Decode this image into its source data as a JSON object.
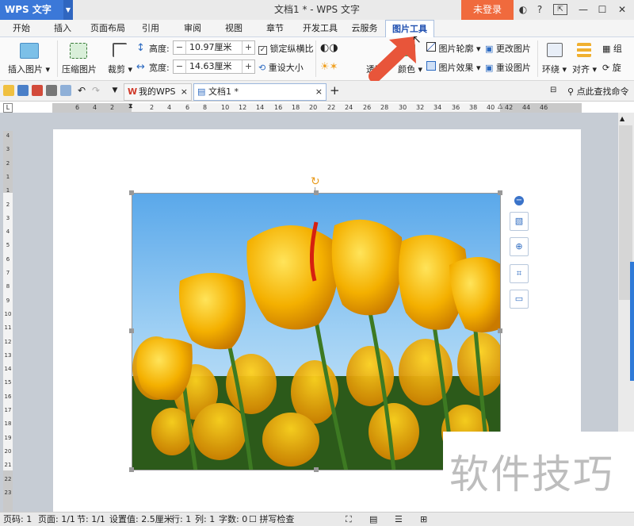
{
  "app": {
    "logo": "WPS 文字",
    "title": "文档1 * - WPS 文字",
    "login": "未登录"
  },
  "window_controls": {
    "help": "?",
    "minimize": "—",
    "restore": "☐",
    "close": "✕"
  },
  "tabs": [
    "开始",
    "插入",
    "页面布局",
    "引用",
    "审阅",
    "视图",
    "章节",
    "开发工具",
    "云服务",
    "图片工具"
  ],
  "active_tab": "图片工具",
  "ribbon": {
    "insert_picture": "插入图片",
    "compress_picture": "压缩图片",
    "crop": "裁剪",
    "height_label": "高度:",
    "height_value": "10.97厘米",
    "width_label": "宽度:",
    "width_value": "14.63厘米",
    "lock_ratio": "锁定纵横比",
    "reset_size": "重设大小",
    "transparent": "透明",
    "color": "颜色",
    "picture_outline": "图片轮廓",
    "picture_effect": "图片效果",
    "change_picture": "更改图片",
    "reset_picture": "重设图片",
    "wrap": "环绕",
    "align": "对齐",
    "group": "组",
    "rotate": "旋"
  },
  "docbar": {
    "tab_my_wps": "我的WPS",
    "tab_doc": "文档1 *",
    "add": "+",
    "search_command": "点此查找命令"
  },
  "hruler_numbers": [
    "6",
    "4",
    "2",
    "2",
    "4",
    "6",
    "8",
    "10",
    "12",
    "14",
    "16",
    "18",
    "20",
    "22",
    "24",
    "26",
    "28",
    "30",
    "32",
    "34",
    "36",
    "38",
    "40",
    "42",
    "44",
    "46"
  ],
  "vruler_numbers": [
    "4",
    "3",
    "2",
    "1",
    "1",
    "2",
    "3",
    "4",
    "5",
    "6",
    "7",
    "8",
    "9",
    "10",
    "11",
    "12",
    "13",
    "14",
    "15",
    "16",
    "17",
    "18",
    "19",
    "20",
    "21",
    "22",
    "23"
  ],
  "statusbar": {
    "page_code": "页码: 1",
    "page": "页面: 1/1",
    "section": "节: 1/1",
    "set_value": "设置值: 2.5厘米",
    "row": "行: 1",
    "col": "列: 1",
    "word_count": "字数: 0",
    "spell_check": "拼写检查"
  },
  "watermark": "软件技巧",
  "colors": {
    "accent": "#3b78d8",
    "login": "#f06a3d",
    "arrow": "#e8553a",
    "workspace": "#c6ccd4"
  }
}
